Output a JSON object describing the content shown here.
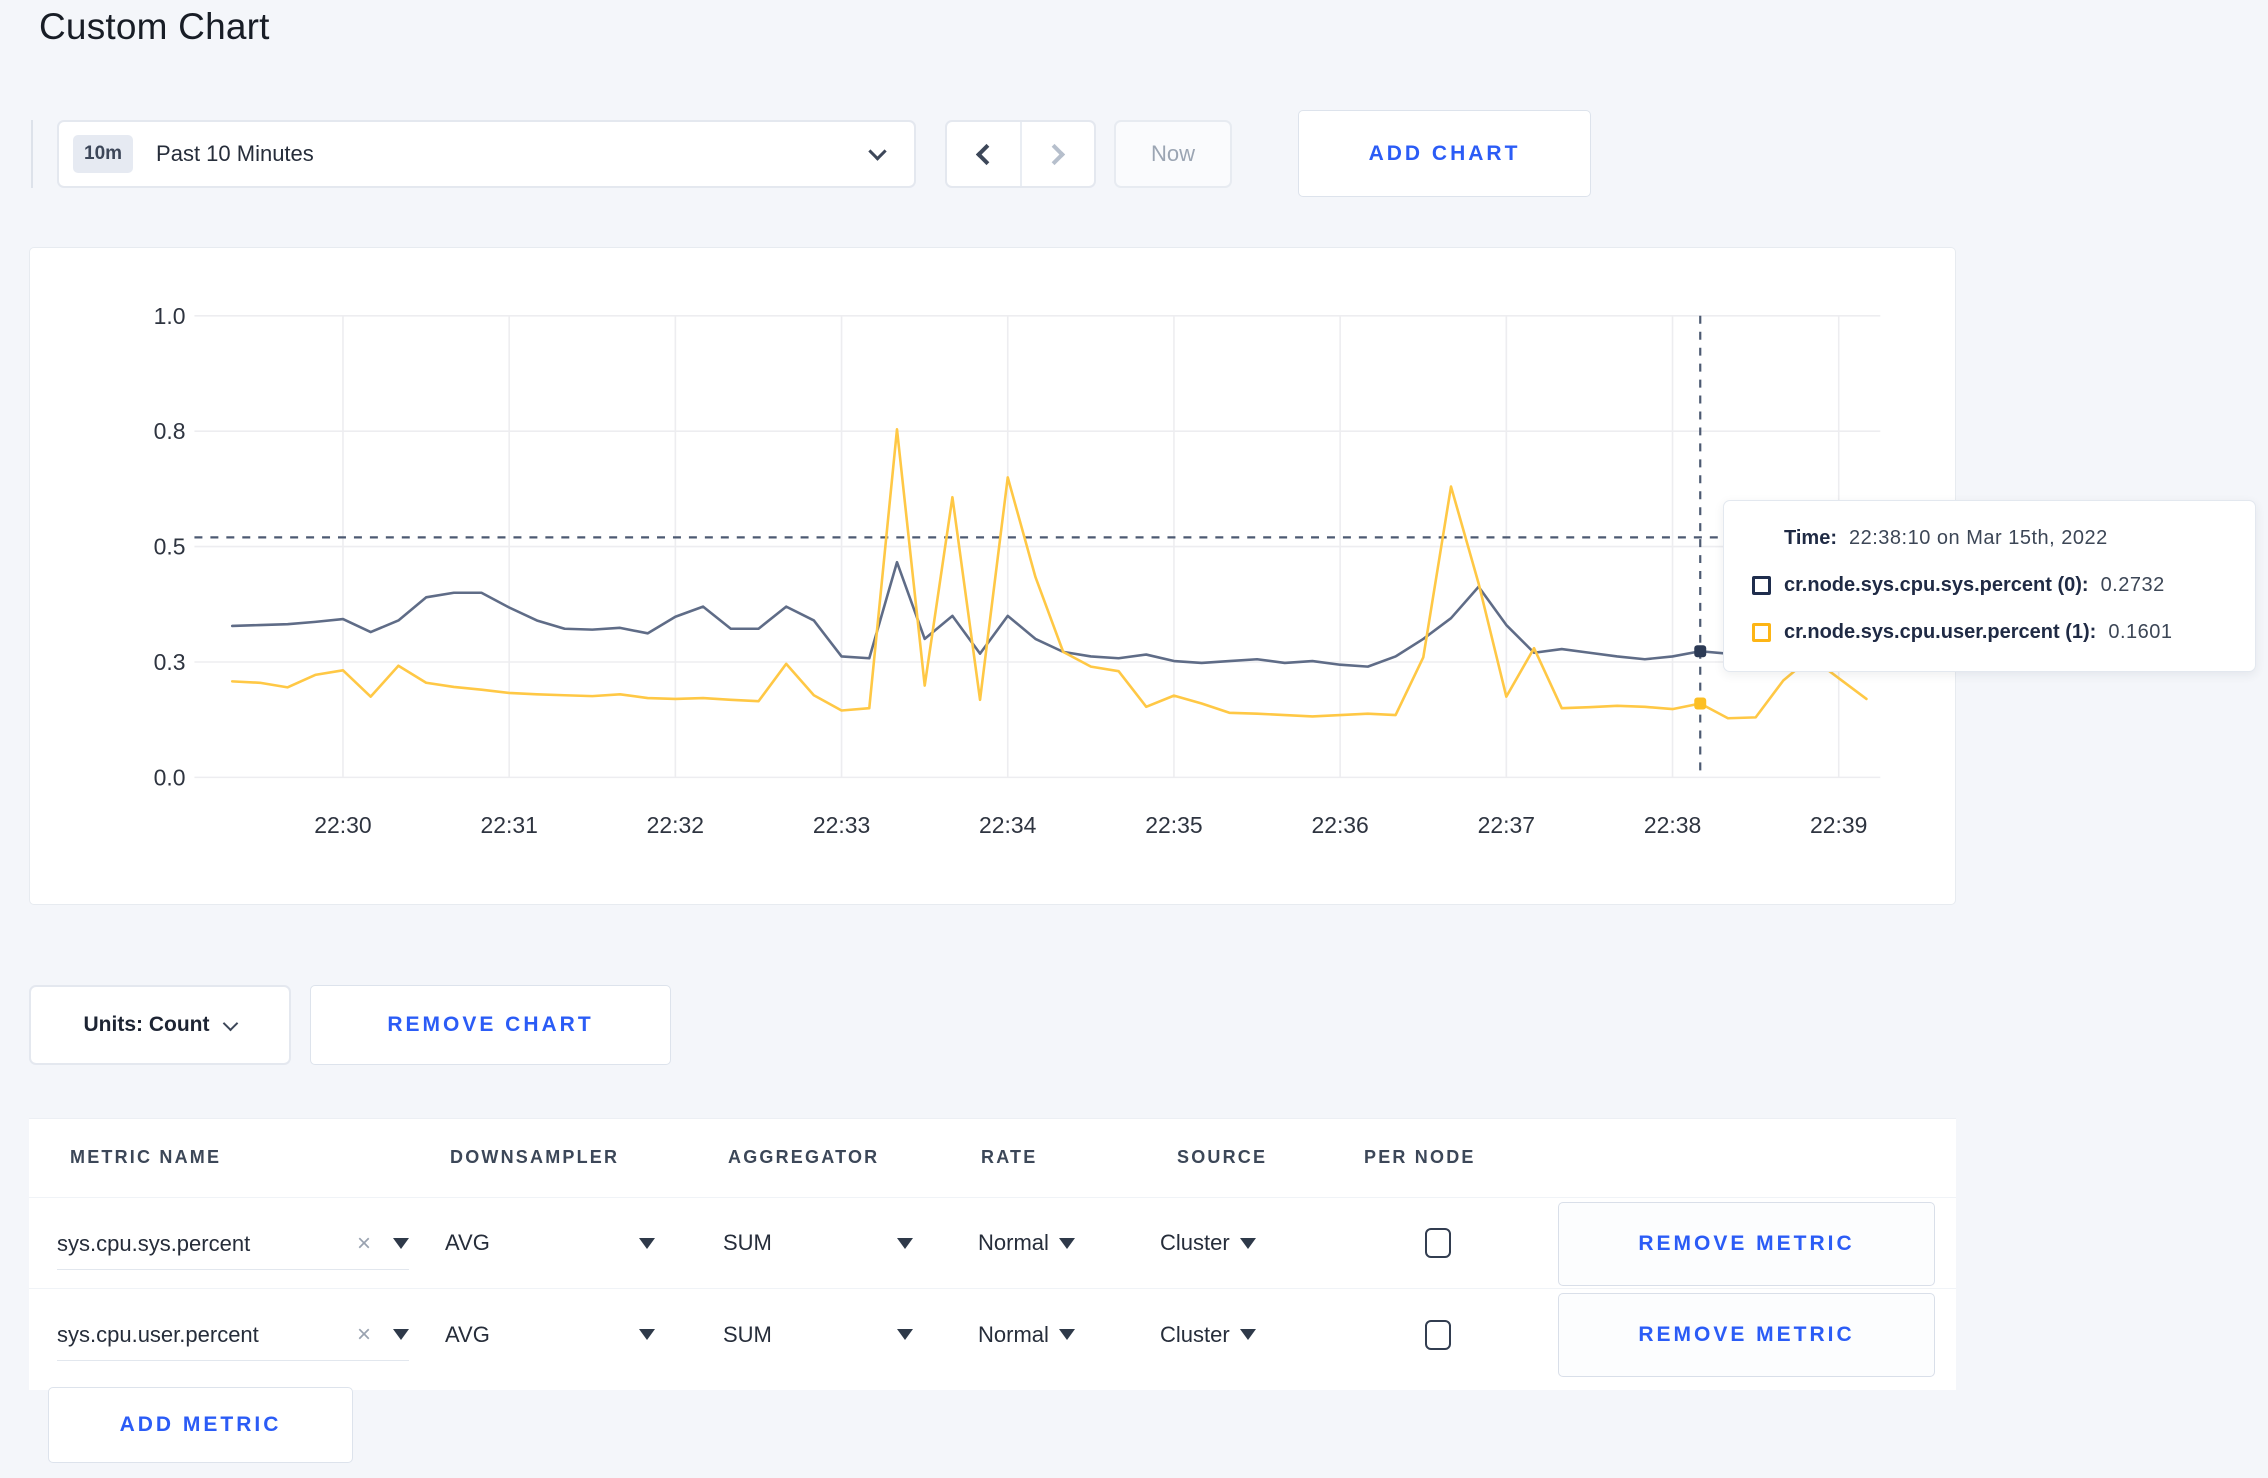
{
  "page": {
    "title": "Custom Chart"
  },
  "toolbar": {
    "time_range": {
      "badge": "10m",
      "label": "Past 10 Minutes"
    },
    "prev_icon": "chevron-left",
    "next_icon": "chevron-right",
    "now_label": "Now",
    "add_chart_label": "ADD CHART"
  },
  "chart_card": {
    "tooltip": {
      "time_label": "Time:",
      "time_value": "22:38:10 on Mar 15th, 2022",
      "series": [
        {
          "label": "cr.node.sys.cpu.sys.percent (0):",
          "value": "0.2732",
          "swatch_color": "#1f2d4d"
        },
        {
          "label": "cr.node.sys.cpu.user.percent (1):",
          "value": "0.1601",
          "swatch_color": "#fdb515"
        }
      ]
    }
  },
  "chart_data": {
    "type": "line",
    "title": "",
    "xlabel": "",
    "ylabel": "",
    "grid": true,
    "legend": "none (tooltip only)",
    "ylim": [
      0,
      1
    ],
    "y_ticks": [
      {
        "value": 0,
        "label": "0.0"
      },
      {
        "value": 0.25,
        "label": "0.3"
      },
      {
        "value": 0.5,
        "label": "0.5"
      },
      {
        "value": 0.75,
        "label": "0.8"
      },
      {
        "value": 1.0,
        "label": "1.0"
      }
    ],
    "x_ticks": [
      "22:30",
      "22:31",
      "22:32",
      "22:33",
      "22:34",
      "22:35",
      "22:36",
      "22:37",
      "22:38",
      "22:39"
    ],
    "x_start": "22:29:20",
    "x_step_seconds": 10,
    "crosshair": {
      "time": "22:38:10",
      "index": 53,
      "y_value": 0.52,
      "color": "#4d5a72"
    },
    "gridline_color": "#ededf0",
    "series": [
      {
        "name": "cr.node.sys.cpu.sys.percent",
        "color": "#5f6c87",
        "marker_color": "#2c3a55",
        "hover_value": 0.2732,
        "values": [
          0.328,
          0.33,
          0.332,
          0.337,
          0.343,
          0.315,
          0.34,
          0.39,
          0.4,
          0.4,
          0.368,
          0.34,
          0.322,
          0.32,
          0.324,
          0.312,
          0.348,
          0.37,
          0.322,
          0.322,
          0.37,
          0.34,
          0.262,
          0.258,
          0.466,
          0.3,
          0.35,
          0.268,
          0.35,
          0.3,
          0.272,
          0.262,
          0.258,
          0.266,
          0.252,
          0.248,
          0.252,
          0.256,
          0.248,
          0.252,
          0.244,
          0.24,
          0.262,
          0.3,
          0.345,
          0.413,
          0.33,
          0.27,
          0.278,
          0.27,
          0.262,
          0.256,
          0.262,
          0.2732,
          0.268,
          0.255,
          0.258,
          0.262,
          0.272,
          0.3
        ]
      },
      {
        "name": "cr.node.sys.cpu.user.percent",
        "color": "#ffc845",
        "marker_color": "#fcbf24",
        "hover_value": 0.1601,
        "values": [
          0.208,
          0.205,
          0.195,
          0.222,
          0.232,
          0.175,
          0.242,
          0.205,
          0.196,
          0.19,
          0.183,
          0.18,
          0.178,
          0.176,
          0.18,
          0.172,
          0.17,
          0.172,
          0.168,
          0.165,
          0.246,
          0.178,
          0.145,
          0.15,
          0.754,
          0.199,
          0.607,
          0.168,
          0.65,
          0.434,
          0.272,
          0.24,
          0.23,
          0.153,
          0.177,
          0.16,
          0.14,
          0.138,
          0.135,
          0.132,
          0.135,
          0.138,
          0.135,
          0.26,
          0.63,
          0.42,
          0.175,
          0.28,
          0.15,
          0.152,
          0.155,
          0.153,
          0.148,
          0.1601,
          0.128,
          0.13,
          0.21,
          0.26,
          0.215,
          0.17
        ]
      }
    ]
  },
  "units": {
    "label": "Units: Count"
  },
  "remove_chart_label": "REMOVE CHART",
  "metrics_table": {
    "headers": [
      "METRIC NAME",
      "DOWNSAMPLER",
      "AGGREGATOR",
      "RATE",
      "SOURCE",
      "PER NODE"
    ],
    "rows": [
      {
        "metric": "sys.cpu.sys.percent",
        "clear": "×",
        "downsampler": "AVG",
        "aggregator": "SUM",
        "rate": "Normal",
        "source": "Cluster",
        "per_node_checked": false,
        "remove_label": "REMOVE METRIC"
      },
      {
        "metric": "sys.cpu.user.percent",
        "clear": "×",
        "downsampler": "AVG",
        "aggregator": "SUM",
        "rate": "Normal",
        "source": "Cluster",
        "per_node_checked": false,
        "remove_label": "REMOVE METRIC"
      }
    ],
    "add_metric_label": "ADD METRIC"
  }
}
